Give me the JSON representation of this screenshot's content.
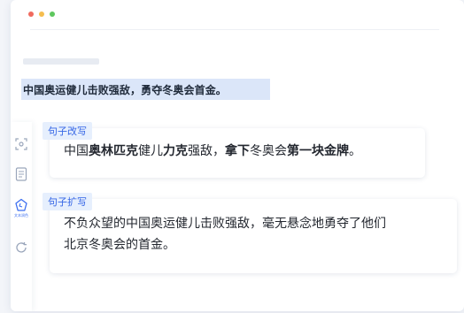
{
  "window": {
    "dot_colors": [
      "#f06a5e",
      "#f5bd4f",
      "#5ec75e"
    ]
  },
  "selection": {
    "text": "中国奥运健儿击败强敌，勇夺冬奥会首金。"
  },
  "sidebar": {
    "items": [
      {
        "icon": "scan-icon",
        "caption": ""
      },
      {
        "icon": "document-icon",
        "caption": ""
      },
      {
        "icon": "text-polish-icon",
        "caption": "文本润色",
        "active": true
      },
      {
        "icon": "refresh-icon",
        "caption": ""
      }
    ]
  },
  "suggestions": [
    {
      "tag": "句子改写",
      "segments": [
        {
          "text": "中国",
          "bold": false
        },
        {
          "text": "奥林匹克",
          "bold": true
        },
        {
          "text": "健儿",
          "bold": false
        },
        {
          "text": "力克",
          "bold": true
        },
        {
          "text": "强敌，",
          "bold": false
        },
        {
          "text": "拿下",
          "bold": true
        },
        {
          "text": "冬奥会",
          "bold": false
        },
        {
          "text": "第一块金牌",
          "bold": true
        },
        {
          "text": "。",
          "bold": false
        }
      ]
    },
    {
      "tag": "句子扩写",
      "line1": "不负众望的中国奥运健儿击败强敌，毫无悬念地勇夺了他们",
      "line2": "北京冬奥会的首金。"
    }
  ],
  "colors": {
    "accent": "#3566e6",
    "tag_bg": "#e6effd",
    "selection_bg": "#dbe6f9"
  }
}
